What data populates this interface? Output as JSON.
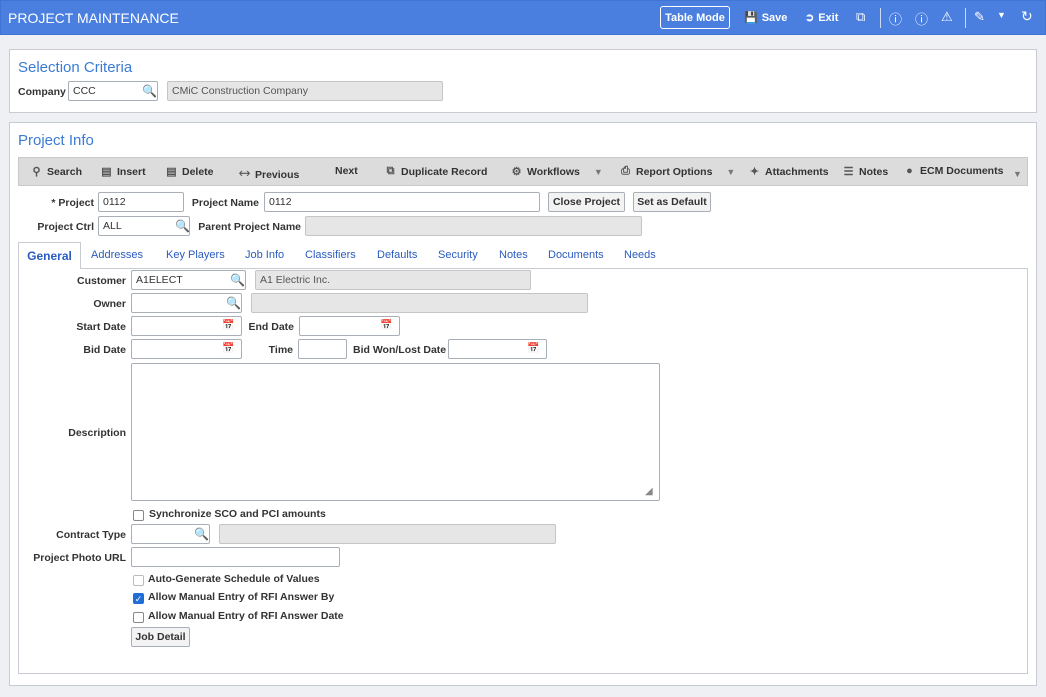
{
  "header": {
    "title": "PROJECT MAINTENANCE",
    "table_mode": "Table Mode",
    "save": "Save",
    "exit": "Exit"
  },
  "selection": {
    "title": "Selection Criteria",
    "company_label": "Company",
    "company_value": "CCC",
    "company_name": "CMiC Construction Company"
  },
  "project_info": {
    "title": "Project Info",
    "toolbar": {
      "search": "Search",
      "insert": "Insert",
      "delete": "Delete",
      "previous": "Previous",
      "next": "Next",
      "duplicate": "Duplicate Record",
      "workflows": "Workflows",
      "report_options": "Report Options",
      "attachments": "Attachments",
      "notes": "Notes",
      "ecm": "ECM Documents"
    },
    "project_label": "* Project",
    "project_value": "0112",
    "project_name_label": "Project Name",
    "project_name_value": "0112",
    "close_project": "Close Project",
    "set_default": "Set as Default",
    "project_ctrl_label": "Project Ctrl",
    "project_ctrl_value": "ALL",
    "parent_project_label": "Parent Project Name",
    "parent_project_value": ""
  },
  "tabs": [
    "General",
    "Addresses",
    "Key Players",
    "Job Info",
    "Classifiers",
    "Defaults",
    "Security",
    "Notes",
    "Documents",
    "Needs"
  ],
  "general": {
    "customer_label": "Customer",
    "customer_value": "A1ELECT",
    "customer_name": "A1 Electric Inc.",
    "owner_label": "Owner",
    "owner_value": "",
    "start_date_label": "Start Date",
    "end_date_label": "End Date",
    "bid_date_label": "Bid Date",
    "time_label": "Time",
    "bid_won_label": "Bid Won/Lost Date",
    "description_label": "Description",
    "sync_label": "Synchronize SCO and PCI amounts",
    "contract_type_label": "Contract Type",
    "photo_url_label": "Project Photo URL",
    "auto_gen_label": "Auto-Generate Schedule of Values",
    "rfi_by_label": "Allow Manual Entry of RFI Answer By",
    "rfi_date_label": "Allow Manual Entry of RFI Answer Date",
    "job_detail": "Job Detail",
    "sync_checked": false,
    "auto_gen_checked": false,
    "rfi_by_checked": true,
    "rfi_date_checked": false
  },
  "icons": {
    "accent": "#4a7fe0",
    "tab_color": "#2a5bbf"
  }
}
